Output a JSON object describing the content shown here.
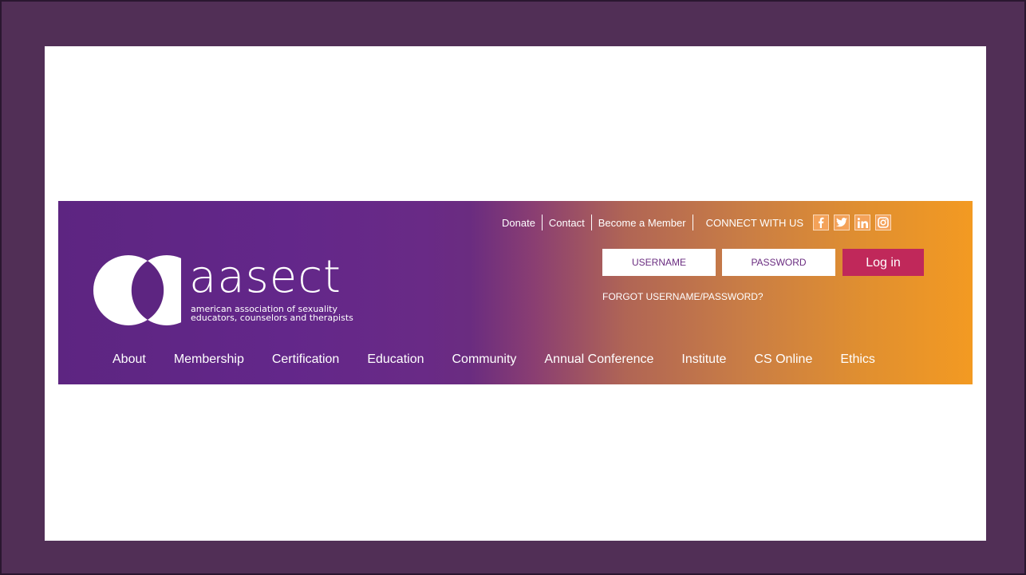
{
  "brand": {
    "name": "aasect",
    "tagline_line1": "american association of sexuality",
    "tagline_line2": "educators, counselors and therapists"
  },
  "top_links": [
    "Donate",
    "Contact",
    "Become a Member"
  ],
  "connect_label": "CONNECT WITH US",
  "social_icons": [
    "facebook-icon",
    "twitter-icon",
    "linkedin-icon",
    "instagram-icon"
  ],
  "login": {
    "username_placeholder": "USERNAME",
    "password_placeholder": "PASSWORD",
    "button_label": "Log in",
    "forgot_label": "FORGOT USERNAME/PASSWORD?"
  },
  "nav": [
    "About",
    "Membership",
    "Certification",
    "Education",
    "Community",
    "Annual Conference",
    "Institute",
    "CS Online",
    "Ethics"
  ],
  "colors": {
    "frame": "#512f56",
    "banner_start": "#5d2581",
    "banner_end": "#f39a22",
    "login_button": "#c0285a"
  }
}
